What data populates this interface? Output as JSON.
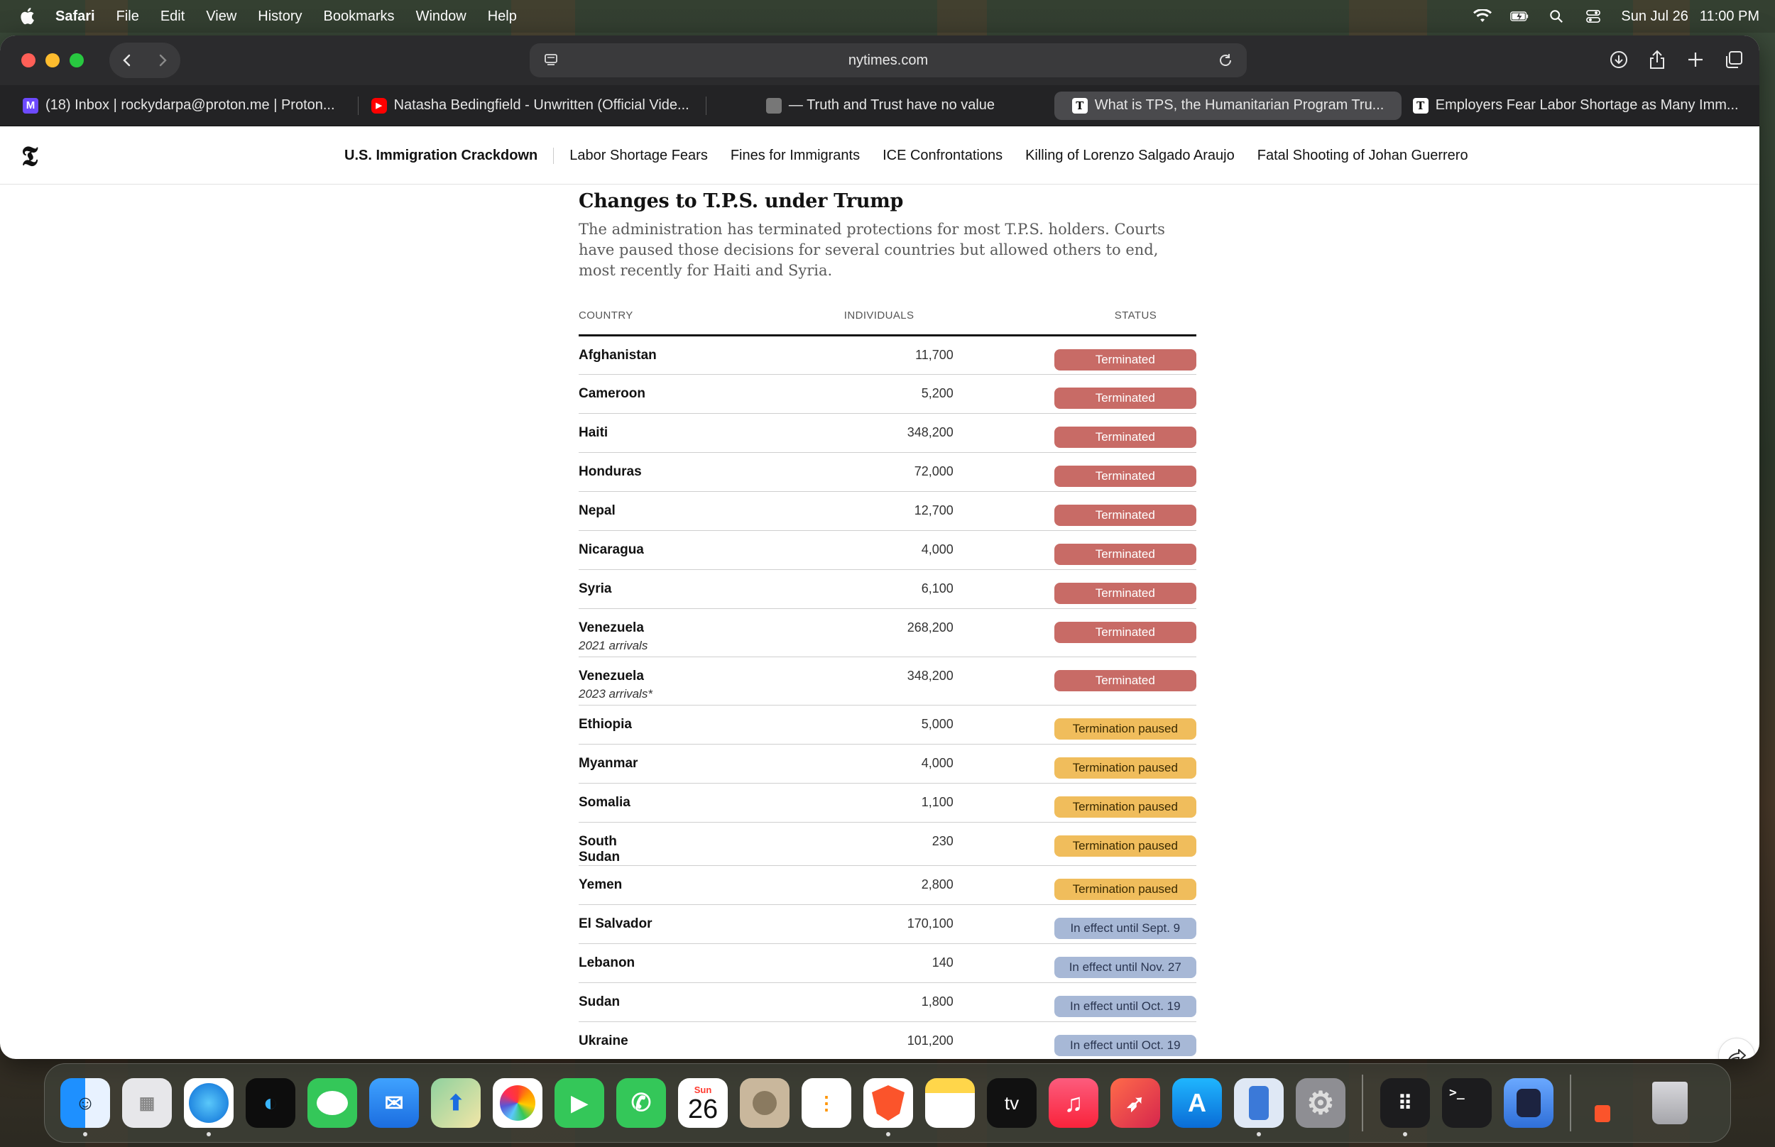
{
  "menubar": {
    "app_name": "Safari",
    "items": [
      "File",
      "Edit",
      "View",
      "History",
      "Bookmarks",
      "Window",
      "Help"
    ],
    "date": "Sun Jul 26",
    "time": "11:00 PM"
  },
  "browser": {
    "url": "nytimes.com",
    "tabs": [
      {
        "title": "(18) Inbox | rockydarpa@proton.me | Proton...",
        "icon": "proton-mail-icon"
      },
      {
        "title": "Natasha Bedingfield - Unwritten (Official Vide...",
        "icon": "youtube-icon"
      },
      {
        "title": "— Truth and Trust have no value",
        "icon": "page-icon"
      },
      {
        "title": "What is TPS, the Humanitarian Program Tru...",
        "icon": "nyt-icon"
      },
      {
        "title": "Employers Fear Labor Shortage as Many Imm...",
        "icon": "nyt-icon"
      }
    ]
  },
  "site_nav": {
    "logo": "𝕿",
    "links": [
      "U.S. Immigration Crackdown",
      "Labor Shortage Fears",
      "Fines for Immigrants",
      "ICE Confrontations",
      "Killing of Lorenzo Salgado Araujo",
      "Fatal Shooting of Johan Guerrero"
    ]
  },
  "article": {
    "heading": "Changes to T.P.S. under Trump",
    "dek": "The administration has terminated protections for most T.P.S. holders. Courts have paused those decisions for several countries but allowed others to end, most recently for Haiti and Syria.",
    "columns": {
      "country": "COUNTRY",
      "individuals": "INDIVIDUALS",
      "status": "STATUS"
    },
    "rows": [
      {
        "country": "Afghanistan",
        "sub": "",
        "individuals": "11,700",
        "status": "Terminated",
        "kind": "term"
      },
      {
        "country": "Cameroon",
        "sub": "",
        "individuals": "5,200",
        "status": "Terminated",
        "kind": "term"
      },
      {
        "country": "Haiti",
        "sub": "",
        "individuals": "348,200",
        "status": "Terminated",
        "kind": "term"
      },
      {
        "country": "Honduras",
        "sub": "",
        "individuals": "72,000",
        "status": "Terminated",
        "kind": "term"
      },
      {
        "country": "Nepal",
        "sub": "",
        "individuals": "12,700",
        "status": "Terminated",
        "kind": "term"
      },
      {
        "country": "Nicaragua",
        "sub": "",
        "individuals": "4,000",
        "status": "Terminated",
        "kind": "term"
      },
      {
        "country": "Syria",
        "sub": "",
        "individuals": "6,100",
        "status": "Terminated",
        "kind": "term"
      },
      {
        "country": "Venezuela",
        "sub": "2021 arrivals",
        "individuals": "268,200",
        "status": "Terminated",
        "kind": "term"
      },
      {
        "country": "Venezuela",
        "sub": "2023 arrivals*",
        "individuals": "348,200",
        "status": "Terminated",
        "kind": "term"
      },
      {
        "country": "Ethiopia",
        "sub": "",
        "individuals": "5,000",
        "status": "Termination paused",
        "kind": "paused"
      },
      {
        "country": "Myanmar",
        "sub": "",
        "individuals": "4,000",
        "status": "Termination paused",
        "kind": "paused"
      },
      {
        "country": "Somalia",
        "sub": "",
        "individuals": "1,100",
        "status": "Termination paused",
        "kind": "paused"
      },
      {
        "country": "South Sudan",
        "sub": "",
        "individuals": "230",
        "status": "Termination paused",
        "kind": "paused"
      },
      {
        "country": "Yemen",
        "sub": "",
        "individuals": "2,800",
        "status": "Termination paused",
        "kind": "paused"
      },
      {
        "country": "El Salvador",
        "sub": "",
        "individuals": "170,100",
        "status": "In effect until Sept. 9",
        "kind": "effect"
      },
      {
        "country": "Lebanon",
        "sub": "",
        "individuals": "140",
        "status": "In effect until Nov. 27",
        "kind": "effect"
      },
      {
        "country": "Sudan",
        "sub": "",
        "individuals": "1,800",
        "status": "In effect until Oct. 19",
        "kind": "effect"
      },
      {
        "country": "Ukraine",
        "sub": "",
        "individuals": "101,200",
        "status": "In effect until Oct. 19",
        "kind": "effect"
      }
    ]
  },
  "dock": {
    "calendar_month": "Sun",
    "calendar_day": "26",
    "tv_label": "tv",
    "apps": [
      "finder-icon",
      "launchpad-icon",
      "safari-icon",
      "podcast-icon",
      "messages-icon",
      "mail-icon",
      "maps-icon",
      "photos-icon",
      "facetime-icon",
      "phone-icon",
      "calendar-icon",
      "contacts-icon",
      "reminders-icon",
      "brave-icon",
      "notes-icon",
      "apple-tv-icon",
      "music-icon",
      "rocket-icon",
      "app-store-icon",
      "simulator-icon",
      "system-settings-icon",
      "app-grid-icon",
      "terminal-icon",
      "db-icon",
      "brave-doc-icon",
      "trash-icon"
    ]
  },
  "colors": {
    "terminated": "#c86b66",
    "paused": "#f0bd5c",
    "in_effect": "#a7b8d6"
  }
}
